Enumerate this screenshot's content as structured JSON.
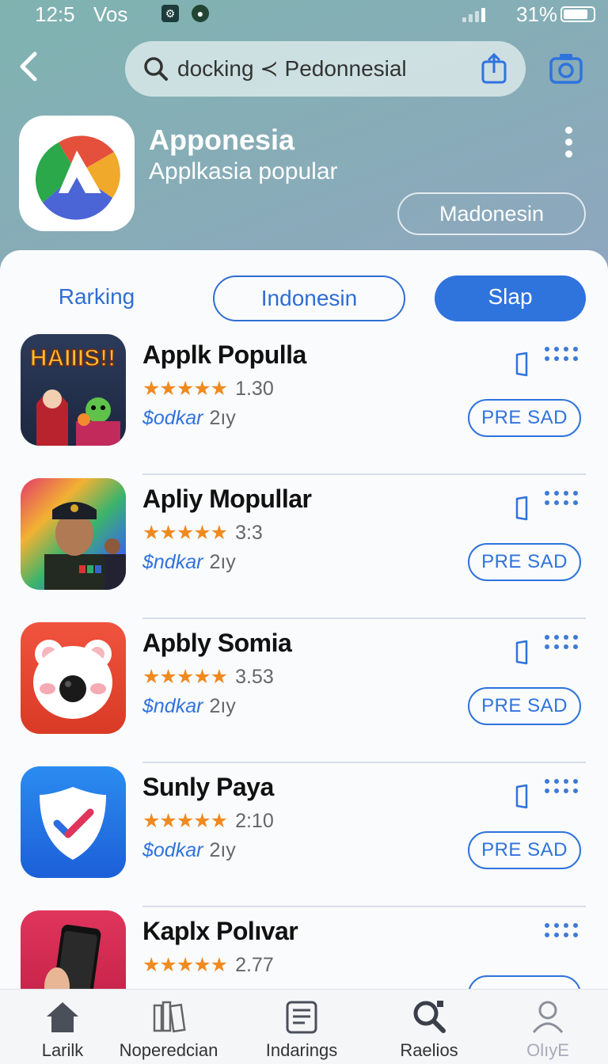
{
  "status_bar": {
    "time": "12:5",
    "carrier": "Vos",
    "battery_pct": "31%"
  },
  "search": {
    "query": "docking ≺ Pedonnesial"
  },
  "app_header": {
    "title": "Apponesia",
    "subtitle": "Applkasia popular",
    "region_button": "Madonesin"
  },
  "tabs": [
    {
      "label": "Rarking"
    },
    {
      "label": "Indonesin"
    },
    {
      "label": "Slap"
    }
  ],
  "apps": [
    {
      "name": "Applk Populla",
      "stars": "★★★★★",
      "rating": "1.30",
      "price": "$odkar",
      "size": "2ıy",
      "button": "PRE SAD"
    },
    {
      "name": "Apliy Mopullar",
      "stars": "★★★★★",
      "rating": "3:3",
      "price": "$ndkar",
      "size": "2ıy",
      "button": "PRE SAD"
    },
    {
      "name": "Apbly Somia",
      "stars": "★★★★★",
      "rating": "3.53",
      "price": "$ndkar",
      "size": "2ıy",
      "button": "PRE SAD"
    },
    {
      "name": "Sunly Paya",
      "stars": "★★★★★",
      "rating": "2:10",
      "price": "$odkar",
      "size": "2ıy",
      "button": "PRE SAD"
    },
    {
      "name": "Kaplx Polıvar",
      "stars": "★★★★★",
      "rating": "2.77",
      "price": "",
      "size": "",
      "button": ""
    }
  ],
  "bottom_nav": [
    {
      "label": "Larilk",
      "icon": "home-icon"
    },
    {
      "label": "Noperedcian",
      "icon": "library-icon"
    },
    {
      "label": "Indarings",
      "icon": "document-icon"
    },
    {
      "label": "Raelios",
      "icon": "search-icon"
    },
    {
      "label": "OlıyE",
      "icon": "profile-icon"
    }
  ],
  "colors": {
    "accent": "#2f73dd",
    "star": "#ef8a1f"
  }
}
